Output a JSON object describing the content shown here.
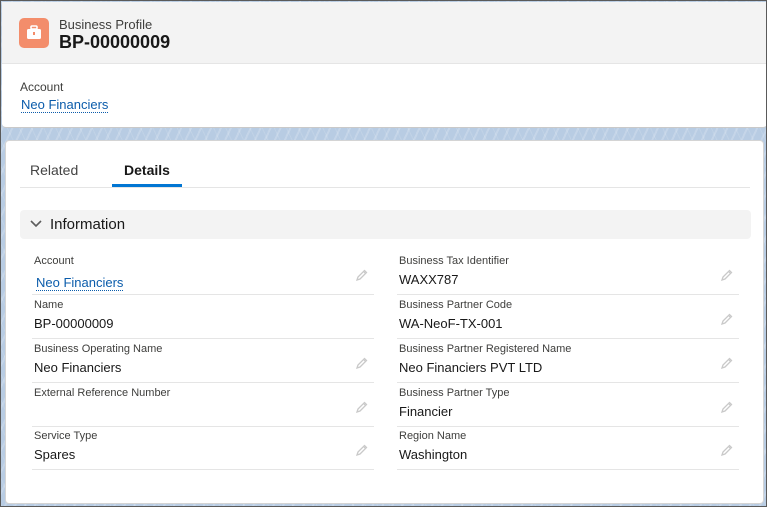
{
  "header": {
    "object_label": "Business Profile",
    "record_title": "BP-00000009",
    "icon": "briefcase-icon",
    "highlight_field": {
      "label": "Account",
      "value": "Neo Financiers"
    }
  },
  "tabs": [
    {
      "label": "Related",
      "active": false
    },
    {
      "label": "Details",
      "active": true
    }
  ],
  "section": {
    "title": "Information",
    "expanded": true
  },
  "fields": {
    "left": [
      {
        "label": "Account",
        "value": "Neo Financiers",
        "is_link": true,
        "editable": true
      },
      {
        "label": "Name",
        "value": "BP-00000009",
        "is_link": false,
        "editable": false
      },
      {
        "label": "Business Operating Name",
        "value": "Neo Financiers",
        "is_link": false,
        "editable": true
      },
      {
        "label": "External Reference Number",
        "value": "",
        "is_link": false,
        "editable": true
      },
      {
        "label": "Service Type",
        "value": "Spares",
        "is_link": false,
        "editable": true
      }
    ],
    "right": [
      {
        "label": "Business Tax Identifier",
        "value": "WAXX787",
        "is_link": false,
        "editable": true
      },
      {
        "label": "Business Partner Code",
        "value": "WA-NeoF-TX-001",
        "is_link": false,
        "editable": true
      },
      {
        "label": "Business Partner Registered Name",
        "value": "Neo Financiers PVT LTD",
        "is_link": false,
        "editable": true
      },
      {
        "label": "Business Partner Type",
        "value": "Financier",
        "is_link": false,
        "editable": true
      },
      {
        "label": "Region Name",
        "value": "Washington",
        "is_link": false,
        "editable": true
      }
    ]
  },
  "colors": {
    "brand_icon": "#f38d6b",
    "link": "#0b5cab",
    "active_tab": "#0176d3"
  }
}
